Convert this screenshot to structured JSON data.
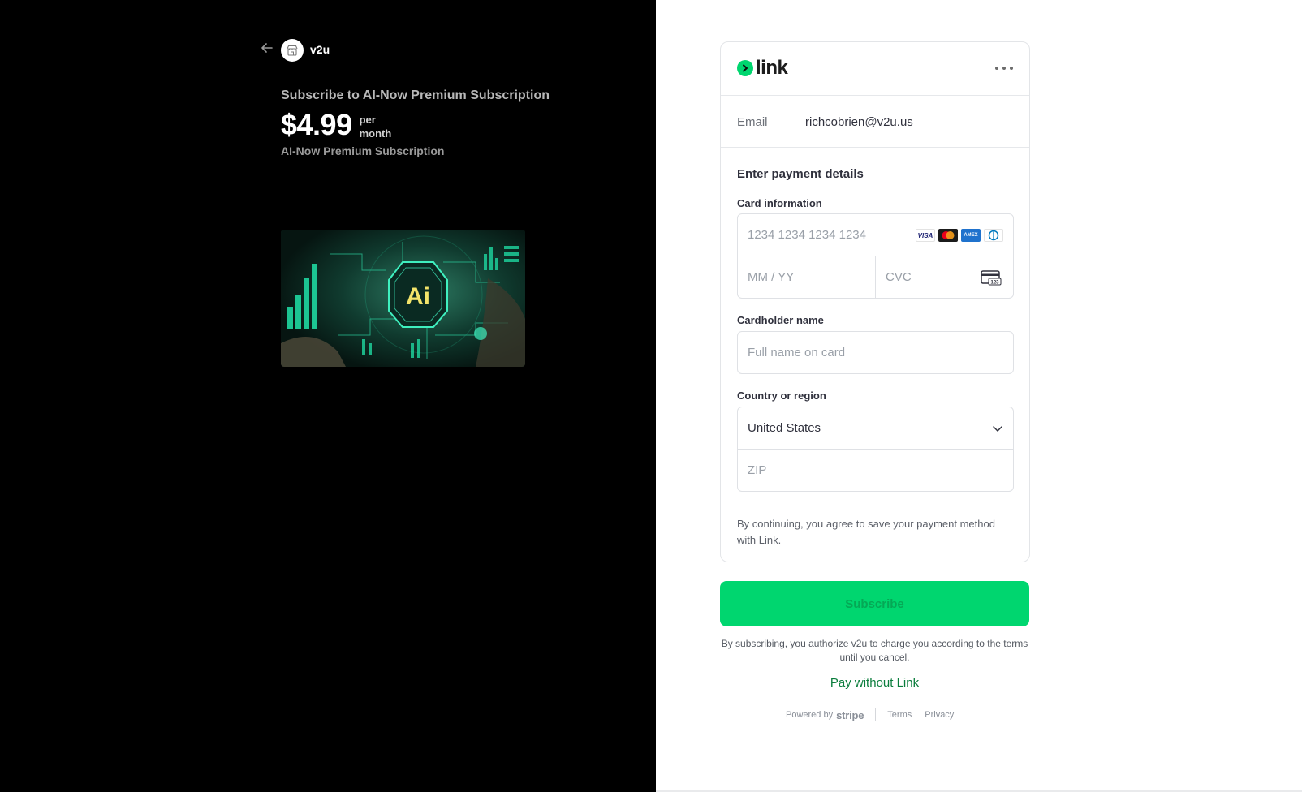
{
  "merchant": {
    "name": "v2u",
    "back_icon": "arrow-left-icon",
    "logo_icon": "store-icon"
  },
  "product": {
    "title": "Subscribe to AI-Now Premium Subscription",
    "price": "$4.99",
    "period_line1": "per",
    "period_line2": "month",
    "description": "AI-Now Premium Subscription",
    "image_text": "Ai"
  },
  "link": {
    "logo_text": "link",
    "more_icon": "more-horizontal-icon"
  },
  "email": {
    "label": "Email",
    "value": "richcobrien@v2u.us"
  },
  "payment": {
    "section_title": "Enter payment details",
    "card_label": "Card information",
    "card_number_placeholder": "1234 1234 1234 1234",
    "expiry_placeholder": "MM / YY",
    "cvc_placeholder": "CVC",
    "cvc_icon_text": "123",
    "brands": {
      "visa": "VISA",
      "amex": "AMEX"
    },
    "cardholder_label": "Cardholder name",
    "cardholder_placeholder": "Full name on card",
    "country_label": "Country or region",
    "country_value": "United States",
    "zip_placeholder": "ZIP",
    "consent": "By continuing, you agree to save your payment method with Link."
  },
  "actions": {
    "subscribe": "Subscribe",
    "authorize_text": "By subscribing, you authorize v2u to charge you according to the terms until you cancel.",
    "pay_without_link": "Pay without Link"
  },
  "footer": {
    "powered_by": "Powered by",
    "stripe": "stripe",
    "terms": "Terms",
    "privacy": "Privacy"
  },
  "colors": {
    "left_background": "#000000",
    "link_green": "#00d66f",
    "pay_without_link": "#0a7d3c"
  }
}
